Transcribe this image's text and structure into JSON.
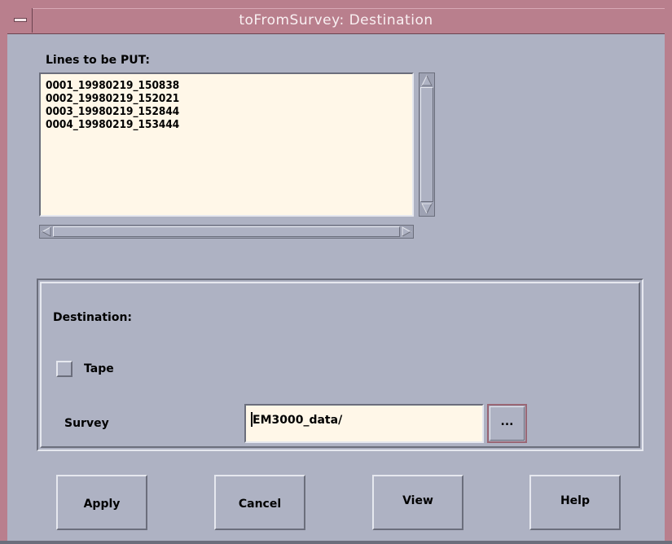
{
  "window": {
    "title": "toFromSurvey: Destination"
  },
  "lines_section": {
    "label": "Lines to be PUT:",
    "items": [
      "0001_19980219_150838",
      "0002_19980219_152021",
      "0003_19980219_152844",
      "0004_19980219_153444"
    ]
  },
  "destination": {
    "label": "Destination:",
    "tape_label": "Tape",
    "tape_checked": false,
    "survey_label": "Survey",
    "survey_value": "EM3000_data/",
    "browse_label": "..."
  },
  "buttons": {
    "apply": "Apply",
    "cancel": "Cancel",
    "view": "View",
    "help": "Help"
  },
  "colors": {
    "background": "#aeb2c3",
    "titlebar": "#b97f8d",
    "field_background": "#fff7e8"
  }
}
